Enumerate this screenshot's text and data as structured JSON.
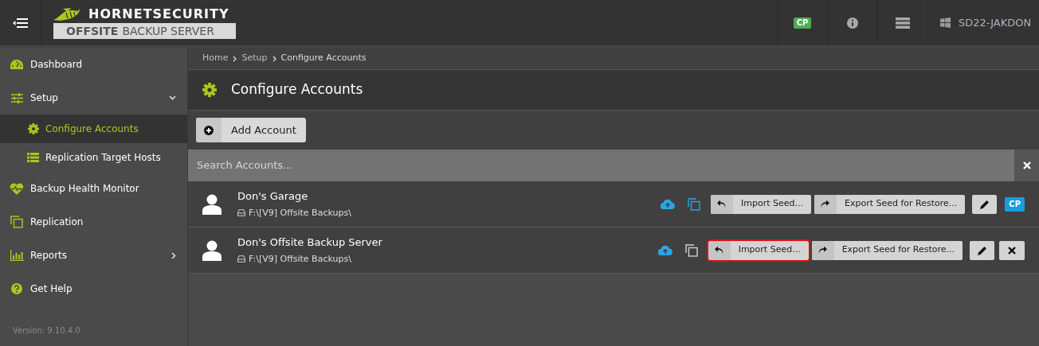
{
  "header": {
    "brand": "HORNETSECURITY",
    "product_bold": "OFFSITE",
    "product_rest": "BACKUP SERVER",
    "cp_badge": "CP",
    "host": "SD22-JAKDON"
  },
  "sidebar": {
    "items": [
      {
        "label": "Dashboard",
        "selected": false
      },
      {
        "label": "Setup",
        "selected": false,
        "expanded": true,
        "children": [
          {
            "label": "Configure Accounts",
            "selected": true
          },
          {
            "label": "Replication Target Hosts",
            "selected": false
          }
        ]
      },
      {
        "label": "Backup Health Monitor",
        "selected": false
      },
      {
        "label": "Replication",
        "selected": false
      },
      {
        "label": "Reports",
        "selected": false,
        "expanded": false
      },
      {
        "label": "Get Help",
        "selected": false
      }
    ],
    "version": "Version: 9.10.4.0"
  },
  "breadcrumbs": [
    "Home",
    "Setup",
    "Configure Accounts"
  ],
  "page_title": "Configure Accounts",
  "add_button": "Add Account",
  "search": {
    "placeholder": "Search Accounts..."
  },
  "accounts": [
    {
      "name": "Don's Garage",
      "path": "F:\\[V9] Offsite Backups\\",
      "replicated": true,
      "import_label": "Import Seed...",
      "import_highlighted": false,
      "export_label": "Export Seed for Restore...",
      "kind": "badge",
      "badge": "CP"
    },
    {
      "name": "Don's Offsite Backup Server",
      "path": "F:\\[V9] Offsite Backups\\",
      "replicated": false,
      "import_label": "Import Seed...",
      "import_highlighted": true,
      "export_label": "Export Seed for Restore...",
      "kind": "delete"
    }
  ]
}
